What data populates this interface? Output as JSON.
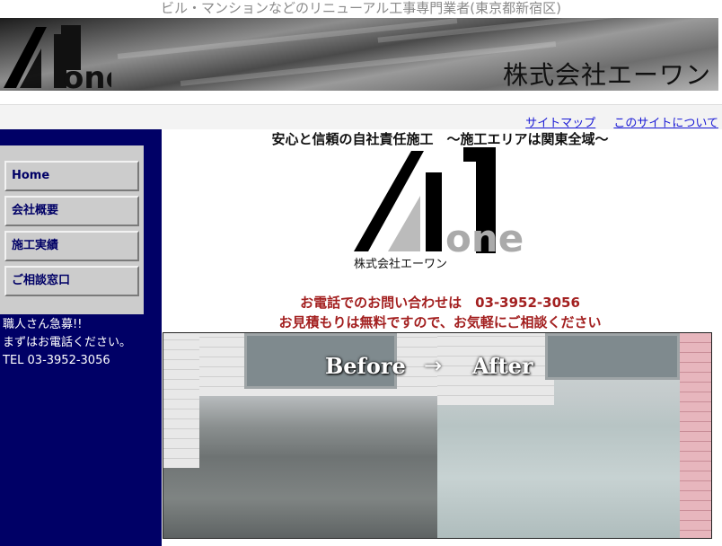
{
  "header": {
    "tagline": "ビル・マンションなどのリニューアル工事専門業者(東京都新宿区)",
    "company_name": "株式会社エーワン",
    "logo_text": "one"
  },
  "top_links": [
    {
      "label": "サイトマップ"
    },
    {
      "label": "このサイトについて"
    }
  ],
  "sidebar": {
    "menu": [
      {
        "label": "Home"
      },
      {
        "label": "会社概要"
      },
      {
        "label": "施工実績"
      },
      {
        "label": "ご相談窓口"
      }
    ],
    "notice_line1": "職人さん急募!!",
    "notice_line2": "まずはお電話ください。",
    "tel": "TEL 03-3952-3056"
  },
  "main": {
    "title": "安心と信頼の自社責任施工　～施工エリアは関東全域～",
    "logo_company": "株式会社エーワン",
    "logo_one": "one",
    "contact_line1": "お電話でのお問い合わせは　03-3952-3056",
    "contact_line2": "お見積もりは無料ですので、お気軽にご相談ください",
    "before_label": "Before",
    "arrow": "→",
    "after_label": "After"
  },
  "colors": {
    "sidebar_bg": "#000066",
    "link": "#1a1ad6",
    "contact_text": "#a32020",
    "menu_bg": "#cccccc"
  }
}
